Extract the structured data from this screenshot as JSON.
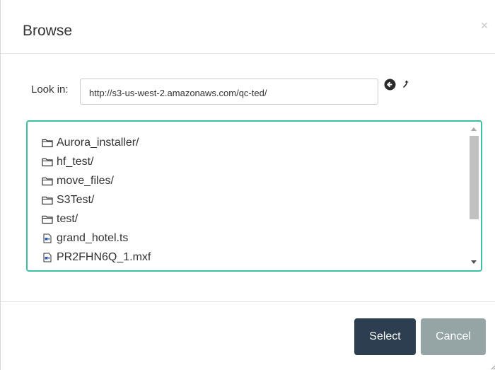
{
  "dialog": {
    "title": "Browse",
    "close_icon": "close-icon"
  },
  "lookin": {
    "label": "Look in:",
    "value": "http://s3-us-west-2.amazonaws.com/qc-ted/",
    "back_icon": "circle-arrow-left-icon",
    "up_icon": "level-up-icon"
  },
  "files": {
    "items": [
      {
        "name": "Aurora_installer/",
        "icon": "folder-icon"
      },
      {
        "name": "hf_test/",
        "icon": "folder-icon"
      },
      {
        "name": "move_files/",
        "icon": "folder-icon"
      },
      {
        "name": "S3Test/",
        "icon": "folder-icon"
      },
      {
        "name": "test/",
        "icon": "folder-icon"
      },
      {
        "name": "grand_hotel.ts",
        "icon": "video-file-icon"
      },
      {
        "name": "PR2FHN6Q_1.mxf",
        "icon": "video-file-icon"
      }
    ],
    "border_color": "#3fbfa2"
  },
  "footer": {
    "select_label": "Select",
    "cancel_label": "Cancel",
    "select_color": "#2c3e50",
    "cancel_color": "#95a5a6"
  }
}
